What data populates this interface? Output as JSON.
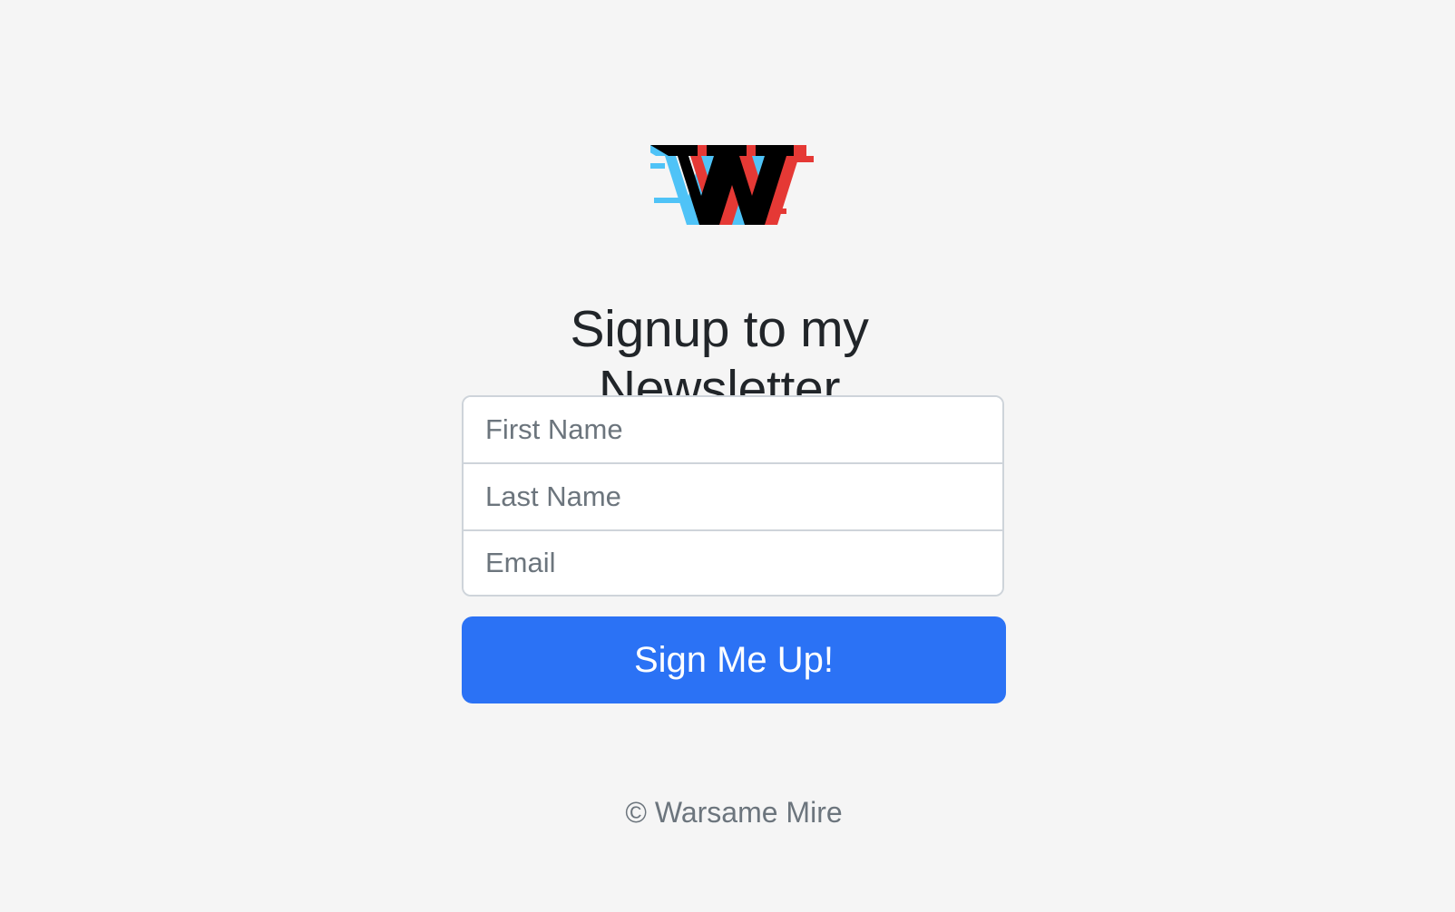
{
  "logo": {
    "letter": "W",
    "colors": {
      "main": "#000000",
      "shadow_blue": "#4fc3f7",
      "shadow_red": "#e53935"
    }
  },
  "heading": "Signup to my Newsletter",
  "form": {
    "first_name_placeholder": "First Name",
    "last_name_placeholder": "Last Name",
    "email_placeholder": "Email",
    "submit_label": "Sign Me Up!"
  },
  "footer": "© Warsame Mire",
  "colors": {
    "background": "#f5f5f5",
    "button": "#2b72f5",
    "heading": "#212529",
    "muted": "#6c757d",
    "border": "#ced4da"
  }
}
